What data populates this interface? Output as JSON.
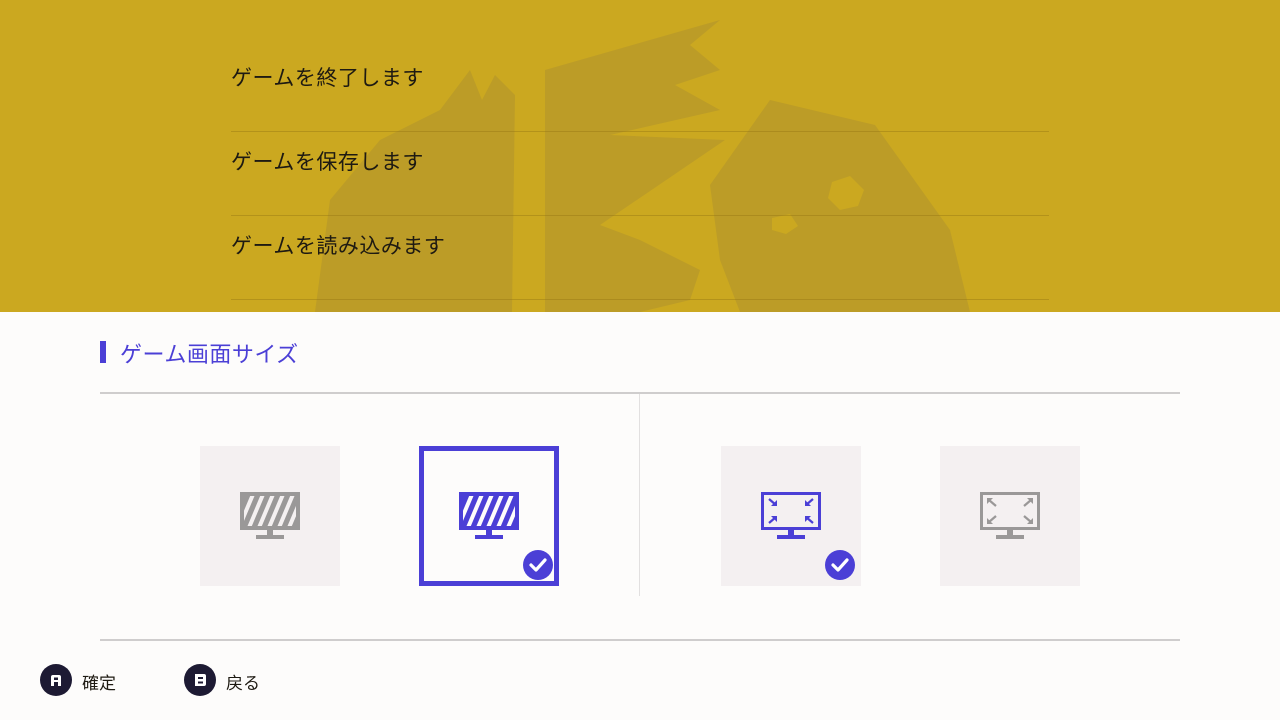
{
  "menu": {
    "items": [
      {
        "label": "ゲームを終了します"
      },
      {
        "label": "ゲームを保存します"
      },
      {
        "label": "ゲームを読み込みます"
      }
    ]
  },
  "settings": {
    "section_title": "ゲーム画面サイズ",
    "accent_color": "#4b3fd6",
    "options": [
      {
        "icon": "monitor-striped-icon",
        "selected": false,
        "checked": false
      },
      {
        "icon": "monitor-striped-icon",
        "selected": true,
        "checked": true
      },
      {
        "icon": "monitor-shrink-arrows-icon",
        "selected": false,
        "checked": true
      },
      {
        "icon": "monitor-expand-arrows-icon",
        "selected": false,
        "checked": false
      }
    ]
  },
  "footer": {
    "confirm": {
      "button": "A",
      "label": "確定"
    },
    "back": {
      "button": "B",
      "label": "戻る"
    }
  },
  "colors": {
    "top_background": "#cba820",
    "panel_background": "#fdfcfb",
    "inactive_icon": "#9a9898"
  }
}
